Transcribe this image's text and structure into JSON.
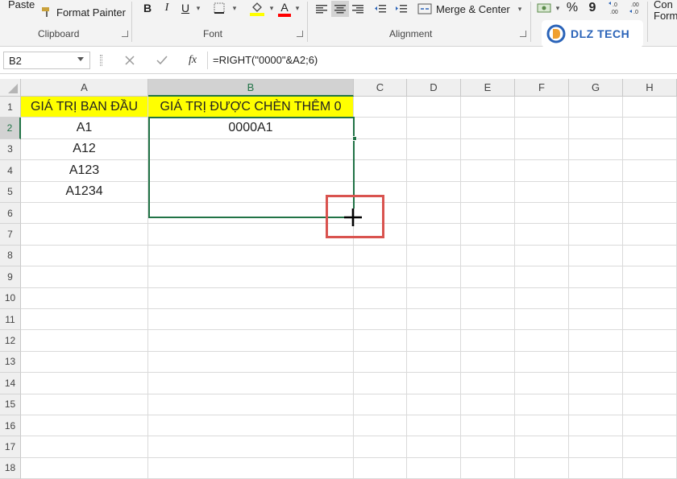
{
  "ribbon": {
    "paste_label": "Paste",
    "format_painter_label": "Format Painter",
    "clipboard_group": "Clipboard",
    "font_group": "Font",
    "alignment_group": "Alignment",
    "bold": "B",
    "italic": "I",
    "underline": "U",
    "merge_center_label": "Merge & Center",
    "percent": "%",
    "comma": "9",
    "cond_format_line1": "Con",
    "cond_format_line2": "Form",
    "font_color_letter": "A",
    "highlight_color": "#ffff00",
    "font_color": "#ff0000"
  },
  "logo": {
    "text": "DLZ TECH"
  },
  "formula_bar": {
    "name_box": "B2",
    "cancel_icon": "x-icon",
    "enter_icon": "check-icon",
    "fx": "fx",
    "formula": "=RIGHT(\"0000\"&A2;6)"
  },
  "grid": {
    "columns": [
      "A",
      "B",
      "C",
      "D",
      "E",
      "F",
      "G",
      "H"
    ],
    "rows": [
      "1",
      "2",
      "3",
      "4",
      "5",
      "6",
      "7",
      "8",
      "9",
      "10",
      "11",
      "12",
      "13",
      "14",
      "15",
      "16",
      "17",
      "18"
    ],
    "cells": {
      "A1": "GIÁ TRỊ BAN ĐẦU",
      "B1": "GIÁ TRỊ ĐƯỢC CHÈN THÊM 0",
      "A2": "A1",
      "B2": "0000A1",
      "A3": "A12",
      "A4": "A123",
      "A5": "A1234"
    },
    "selected_column": "B",
    "selected_row": "2",
    "selection_color": "#217346",
    "annotation_color": "#d9534f"
  }
}
